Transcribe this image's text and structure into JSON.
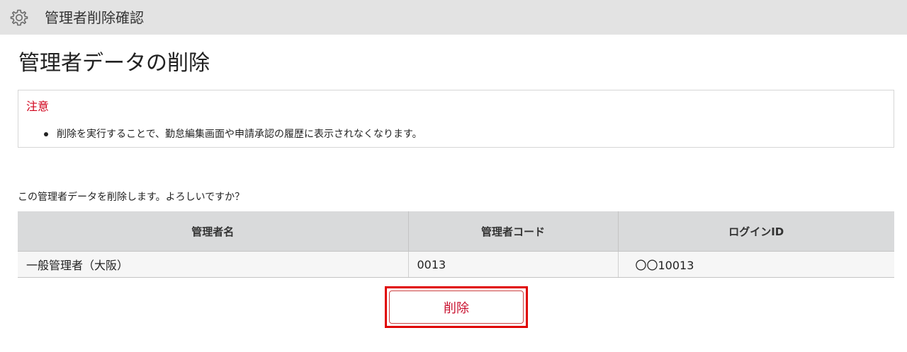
{
  "header": {
    "icon": "gear-icon",
    "title": "管理者削除確認"
  },
  "page_title": "管理者データの削除",
  "notice": {
    "title": "注意",
    "items": [
      "削除を実行することで、勤怠編集画面や申請承認の履歴に表示されなくなります。"
    ],
    "title_color": "#d0021b"
  },
  "confirm_text": "この管理者データを削除します。よろしいですか？",
  "table": {
    "columns": [
      "管理者名",
      "管理者コード",
      "ログインID"
    ],
    "rows": [
      [
        "一般管理者（大阪）",
        "0013",
        "〇〇10013"
      ]
    ]
  },
  "delete_button": {
    "label": "削除",
    "color": "#c8102e",
    "highlight_color": "#e00000"
  }
}
